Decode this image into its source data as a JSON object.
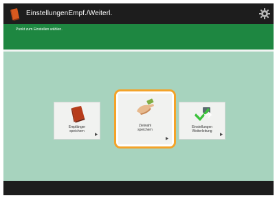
{
  "titlebar": {
    "title": "EinstellungenEmpf./Weiterl."
  },
  "message": {
    "text": "Punkt zum Einstellen wählen."
  },
  "tiles": [
    {
      "label": "Empfänger\nspeichern",
      "icon": "red-address-book-icon"
    },
    {
      "label": "Zielwahl\nspeichern",
      "icon": "hand-pointer-icon"
    },
    {
      "label": "Einstellungen\nWeiterleitung",
      "icon": "forwarding-checkmark-icon"
    }
  ],
  "selected_tile_index": 1,
  "colors": {
    "titlebar_bg": "#1d1d1d",
    "message_bar": "#1e8741",
    "background": "#a7d3be",
    "selection": "#f3a32a"
  }
}
